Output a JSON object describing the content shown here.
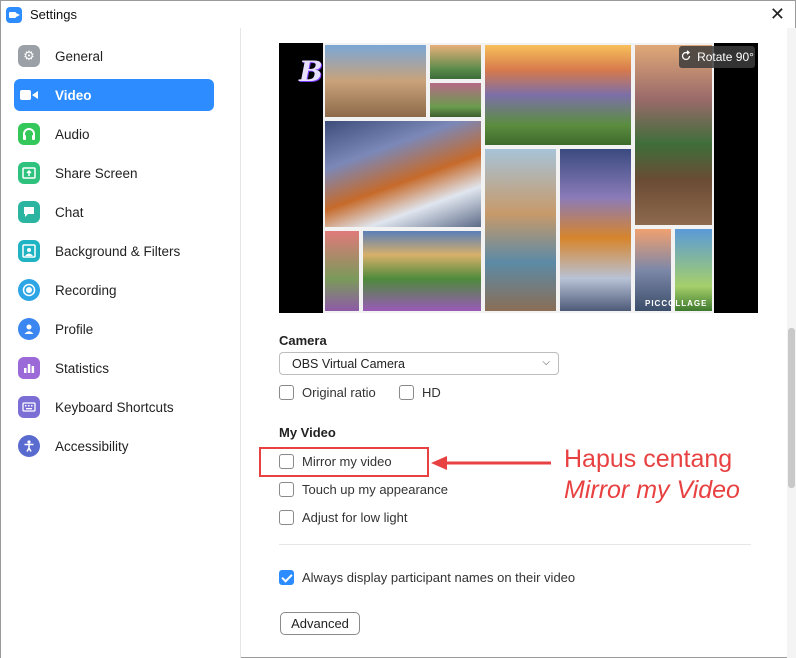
{
  "window": {
    "title": "Settings"
  },
  "sidebar": {
    "items": [
      {
        "label": "General",
        "icon": "gear-icon",
        "color": "#9aa0a6"
      },
      {
        "label": "Video",
        "icon": "video-camera-icon",
        "color": "#2d8cff",
        "active": true
      },
      {
        "label": "Audio",
        "icon": "headphones-icon",
        "color": "#34c759"
      },
      {
        "label": "Share Screen",
        "icon": "share-screen-icon",
        "color": "#2ec27e"
      },
      {
        "label": "Chat",
        "icon": "chat-bubble-icon",
        "color": "#2bb5a0"
      },
      {
        "label": "Background & Filters",
        "icon": "background-person-icon",
        "color": "#1fb3c3"
      },
      {
        "label": "Recording",
        "icon": "record-circle-icon",
        "color": "#2ea6e6"
      },
      {
        "label": "Profile",
        "icon": "person-icon",
        "color": "#3b86f0"
      },
      {
        "label": "Statistics",
        "icon": "bar-chart-icon",
        "color": "#9b6ad8"
      },
      {
        "label": "Keyboard Shortcuts",
        "icon": "keyboard-icon",
        "color": "#7b6fd6"
      },
      {
        "label": "Accessibility",
        "icon": "accessibility-icon",
        "color": "#5a6bd0"
      }
    ]
  },
  "video": {
    "preview": {
      "rotate_label": "Rotate 90°",
      "watermark": "PICCOLLAGE",
      "overlay_letter": "B"
    },
    "camera": {
      "heading": "Camera",
      "selected": "OBS Virtual Camera"
    },
    "options": {
      "original_ratio": "Original ratio",
      "hd": "HD"
    },
    "my_video": {
      "heading": "My Video",
      "mirror": "Mirror my video",
      "touch_up": "Touch up my appearance",
      "low_light": "Adjust for low light"
    },
    "display_names": {
      "label": "Always display participant names on their video",
      "checked": true
    },
    "advanced_label": "Advanced"
  },
  "annotation": {
    "line1": "Hapus centang",
    "line2": "Mirror my Video"
  },
  "colors": {
    "accent": "#2d8cff",
    "annotation_red": "#e84141"
  }
}
